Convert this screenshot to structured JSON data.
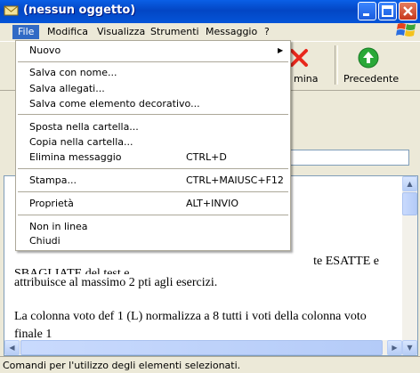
{
  "window": {
    "title": "(nessun oggetto)"
  },
  "menubar": {
    "items": [
      "File",
      "Modifica",
      "Visualizza",
      "Strumenti",
      "Messaggio",
      "?"
    ]
  },
  "toolbar": {
    "delete_label": "mina",
    "prev_label": "Precedente"
  },
  "file_menu": {
    "nuovo": "Nuovo",
    "salva_con_nome": "Salva con nome...",
    "salva_allegati": "Salva allegati...",
    "salva_sfondo": "Salva come elemento decorativo...",
    "sposta": "Sposta nella cartella...",
    "copia": "Copia nella cartella...",
    "elimina": "Elimina messaggio",
    "elimina_shortcut": "CTRL+D",
    "stampa": "Stampa...",
    "stampa_shortcut": "CTRL+MAIUSC+F12",
    "proprieta": "Proprietà",
    "proprieta_shortcut": "ALT+INVIO",
    "non_in_linea": "Non in linea",
    "chiudi": "Chiudi"
  },
  "message_body": {
    "line1_tail": "te ESATTE e",
    "line2": "SBAGLIATE del test e",
    "line3": "attribuisce al massimo 2 pti agli esercizi.",
    "line4": "La colonna voto def 1 (L) normalizza a 8 tutti i voti della colonna voto",
    "line5": "finale 1"
  },
  "status": {
    "text": "Comandi per l'utilizzo degli elementi selezionati."
  },
  "colors": {
    "titlebar": "#0a5fe6",
    "menu_highlight": "#316ac5",
    "delete_red": "#e8281c",
    "prev_green": "#2aa838"
  },
  "icons": [
    "app-mail-icon",
    "minimize-icon",
    "maximize-icon",
    "close-icon",
    "windows-logo-icon",
    "delete-x-icon",
    "previous-arrow-icon"
  ]
}
